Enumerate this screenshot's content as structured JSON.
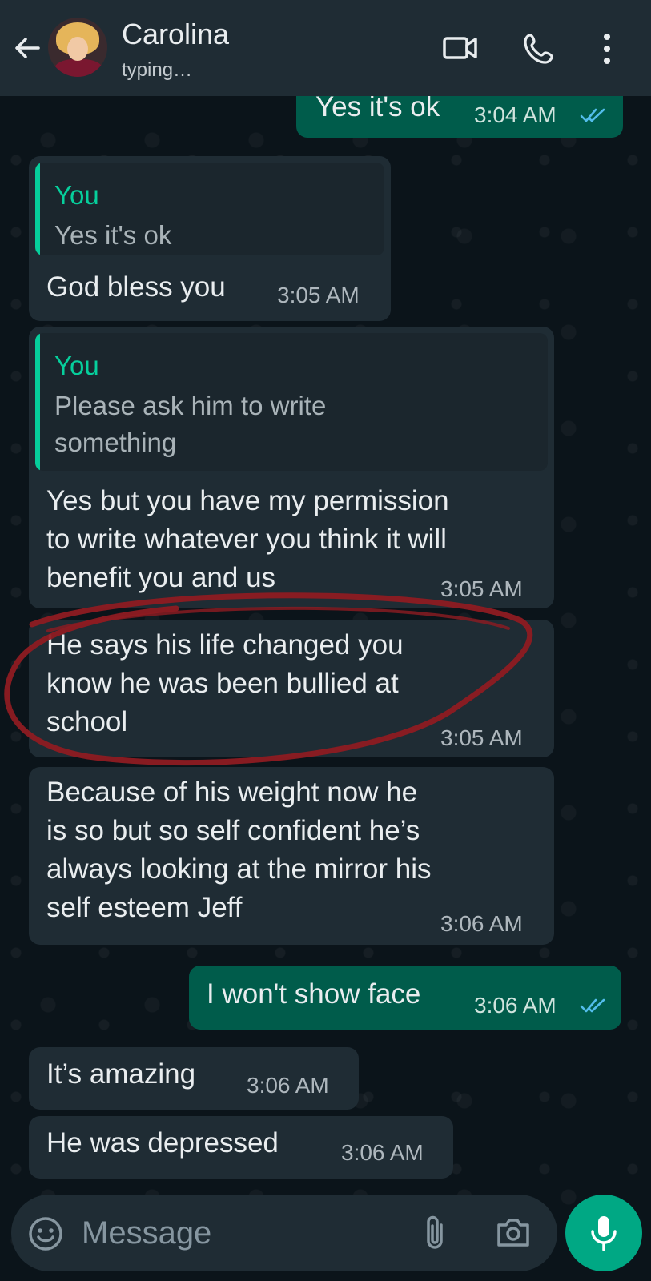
{
  "header": {
    "contact_name": "Carolina",
    "status": "typing…",
    "icons": [
      "back-arrow-icon",
      "video-call-icon",
      "voice-call-icon",
      "more-options-icon"
    ]
  },
  "messages": [
    {
      "dir": "out",
      "text": "Yes it's ok",
      "time": "3:04 AM",
      "read": true
    },
    {
      "dir": "in",
      "quote_author": "You",
      "quote_text": "Yes it's ok",
      "text": "God bless you",
      "time": "3:05 AM"
    },
    {
      "dir": "in",
      "quote_author": "You",
      "quote_text_1": "Please ask him to write",
      "quote_text_2": "something",
      "text_lines": [
        "Yes but you have my permission",
        "to write whatever you think it will",
        "benefit you and us"
      ],
      "time": "3:05 AM"
    },
    {
      "dir": "in",
      "text_lines": [
        "He says his life changed you",
        "know he was been bullied at",
        "school"
      ],
      "time": "3:05 AM",
      "annotated": true
    },
    {
      "dir": "in",
      "text_lines": [
        "Because of his weight now he",
        "is so but so self confident he’s",
        "always looking at the mirror his",
        "self esteem Jeff"
      ],
      "time": "3:06 AM"
    },
    {
      "dir": "out",
      "text": "I won't show face",
      "time": "3:06 AM",
      "read": true
    },
    {
      "dir": "in",
      "text": "It’s amazing",
      "time": "3:06 AM"
    },
    {
      "dir": "in",
      "text": "He was depressed",
      "time": "3:06 AM"
    }
  ],
  "composer": {
    "placeholder": "Message",
    "icons": [
      "emoji-icon",
      "attach-icon",
      "camera-icon",
      "mic-icon"
    ]
  },
  "colors": {
    "accent": "#00a884",
    "incoming_bubble": "#1f2c34",
    "outgoing_bubble": "#005c4b",
    "quote_bar": "#06cf9c",
    "read_ticks": "#53bdeb",
    "annotation": "#8e1b22"
  }
}
